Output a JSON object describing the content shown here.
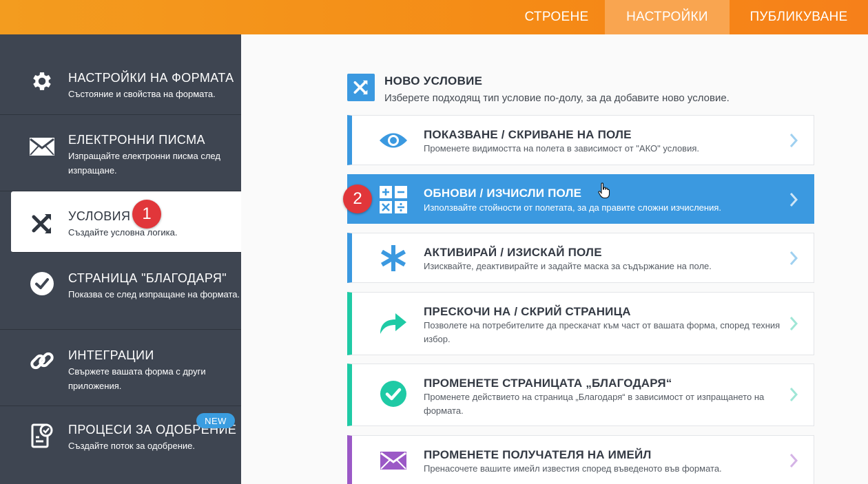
{
  "topnav": {
    "build": "СТРОЕНЕ",
    "settings": "НАСТРОЙКИ",
    "publish": "ПУБЛИКУВАНЕ"
  },
  "sidebar": {
    "items": [
      {
        "title": "НАСТРОЙКИ НА ФОРМАТА",
        "sub": "Състояние и свойства на формата.",
        "icon": "gear-icon"
      },
      {
        "title": "ЕЛЕКТРОННИ ПИСМА",
        "sub": "Изпращайте електронни писма след изпращане.",
        "icon": "envelope-icon"
      },
      {
        "title": "УСЛОВИЯ",
        "sub": "Създайте условна логика.",
        "icon": "conditions-icon"
      },
      {
        "title": "СТРАНИЦА \"БЛАГОДАРЯ\"",
        "sub": "Показва се след изпращане на формата.",
        "icon": "check-circle-icon"
      },
      {
        "title": "ИНТЕГРАЦИИ",
        "sub": "Свържете вашата форма с други приложения.",
        "icon": "link-icon"
      },
      {
        "title": "ПРОЦЕСИ ЗА ОДОБРЕНИЕ",
        "sub": "Създайте поток за одобрение.",
        "icon": "approval-icon"
      }
    ],
    "new_badge": "NEW"
  },
  "annotations": {
    "step1": "1",
    "step2": "2"
  },
  "main": {
    "header": {
      "title": "НОВО УСЛОВИЕ",
      "subtitle": "Изберете подходящ тип условие по-долу, за да добавите ново условие."
    },
    "cards": [
      {
        "title": "ПОКАЗВАНЕ / СКРИВАНЕ НА ПОЛЕ",
        "sub": "Променете видимостта на полета в зависимост от \"АКО\" условия.",
        "color": "#3b99e0",
        "icon": "eye-icon"
      },
      {
        "title": "ОБНОВИ / ИЗЧИСЛИ ПОЛЕ",
        "sub": "Използвайте стойности от полетата, за да правите сложни изчисления.",
        "color": "#3b99e0",
        "icon": "calculator-icon"
      },
      {
        "title": "АКТИВИРАЙ / ИЗИСКАЙ ПОЛЕ",
        "sub": "Изисквайте, деактивирайте и задайте маска за съдържание на поле.",
        "color": "#3b99e0",
        "icon": "asterisk-icon"
      },
      {
        "title": "ПРЕСКОЧИ НА / СКРИЙ СТРАНИЦА",
        "sub": "Позволете на потребителите да прескачат към част от вашата форма, според техния избор.",
        "color": "#1fcaa5",
        "icon": "arrow-forward-icon"
      },
      {
        "title": "ПРОМЕНЕТЕ СТРАНИЦАТА „БЛАГОДАРЯ“",
        "sub": "Променете действието на страница „Благодаря“ в зависимост от изпращането на формата.",
        "color": "#1fcaa5",
        "icon": "check-circle-icon"
      },
      {
        "title": "ПРОМЕНЕТЕ ПОЛУЧАТЕЛЯ НА ИМЕЙЛ",
        "sub": "Пренасочете вашите имейл известия според въведеното във формата.",
        "color": "#9b59c6",
        "icon": "envelope-icon"
      }
    ]
  }
}
